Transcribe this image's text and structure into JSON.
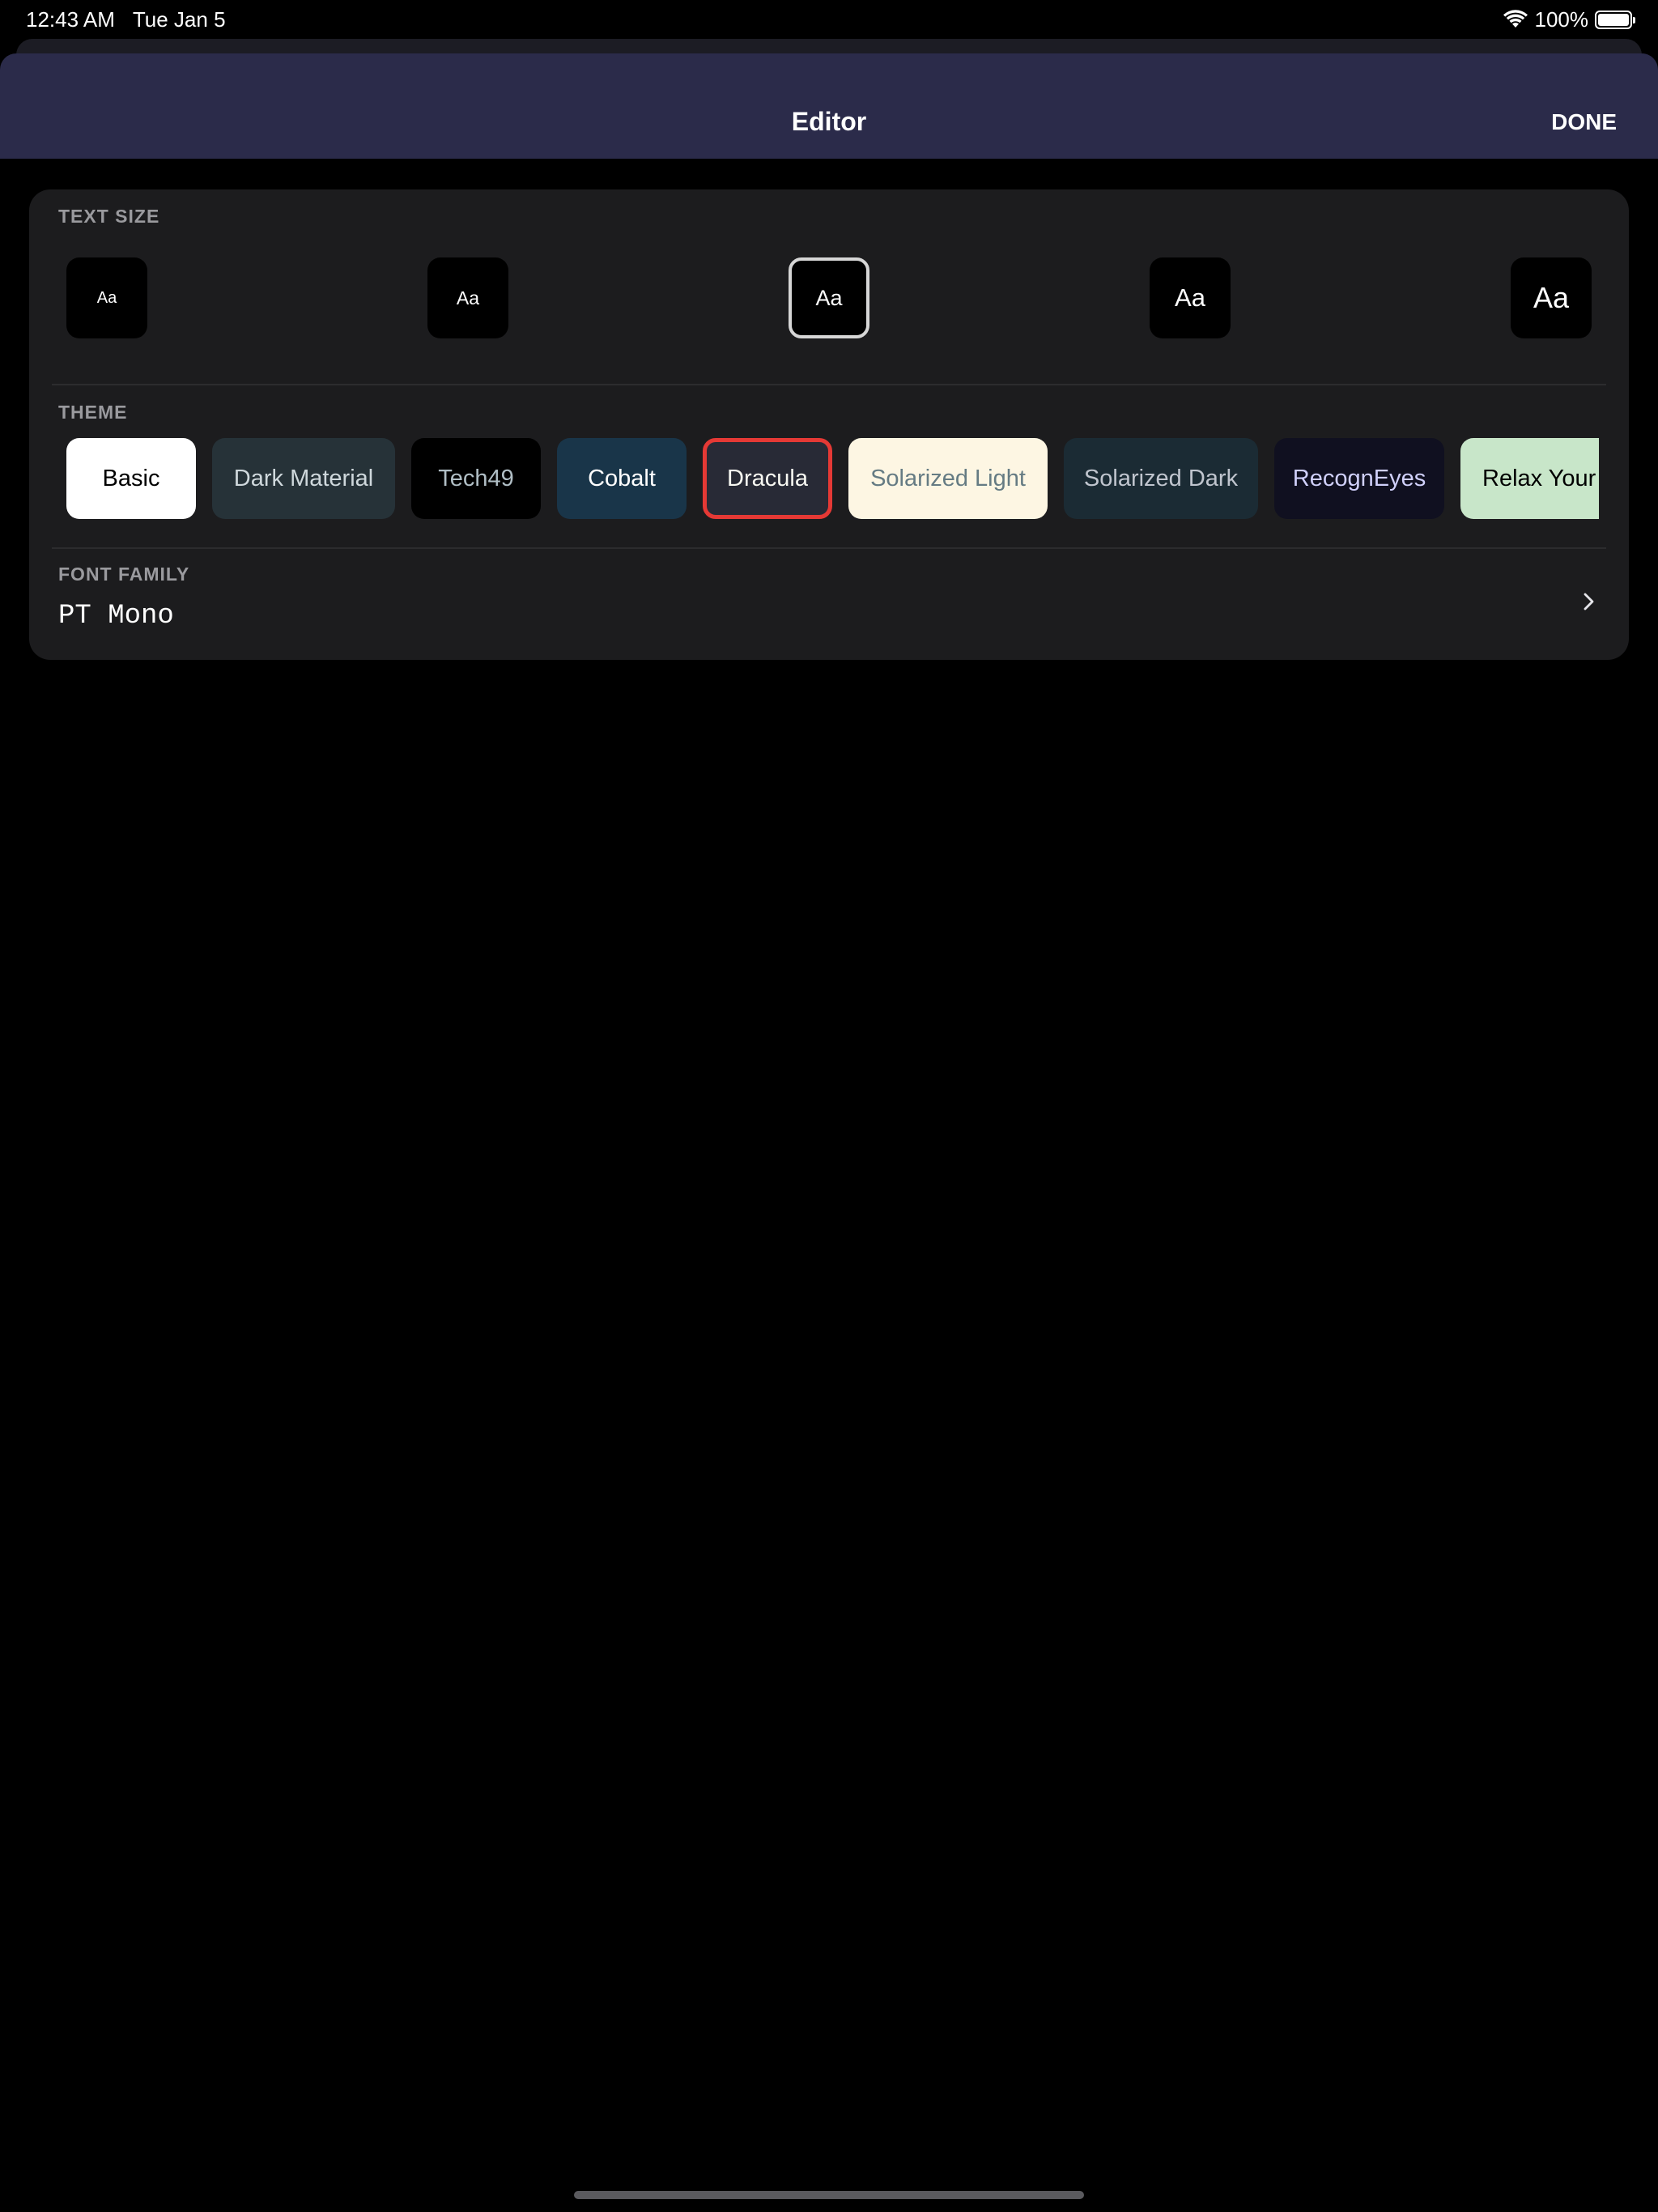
{
  "status_bar": {
    "time": "12:43 AM",
    "date": "Tue Jan 5",
    "battery": "100%"
  },
  "header": {
    "title": "Editor",
    "done_label": "DONE"
  },
  "text_size": {
    "label": "TEXT SIZE",
    "options": [
      {
        "label": "Aa"
      },
      {
        "label": "Aa"
      },
      {
        "label": "Aa"
      },
      {
        "label": "Aa"
      },
      {
        "label": "Aa"
      }
    ],
    "selected_index": 2
  },
  "theme": {
    "label": "THEME",
    "options": [
      {
        "label": "Basic",
        "bg": "#ffffff",
        "fg": "#000000"
      },
      {
        "label": "Dark Material",
        "bg": "#263238",
        "fg": "#cfd8dc"
      },
      {
        "label": "Tech49",
        "bg": "#000000",
        "fg": "#b0bec5"
      },
      {
        "label": "Cobalt",
        "bg": "#193549",
        "fg": "#ffffff"
      },
      {
        "label": "Dracula",
        "bg": "#282a36",
        "fg": "#f8f8f2"
      },
      {
        "label": "Solarized Light",
        "bg": "#fdf6e3",
        "fg": "#657b83"
      },
      {
        "label": "Solarized Dark",
        "bg": "#1b2b34",
        "fg": "#c0c5ce"
      },
      {
        "label": "RecognEyes",
        "bg": "#101020",
        "fg": "#d0d0fa"
      },
      {
        "label": "Relax Your Eyes",
        "bg": "#c8e6c9",
        "fg": "#000000"
      }
    ],
    "selected_index": 4,
    "selected_border": "#e53935"
  },
  "font_family": {
    "label": "FONT FAMILY",
    "value": "PT Mono"
  }
}
